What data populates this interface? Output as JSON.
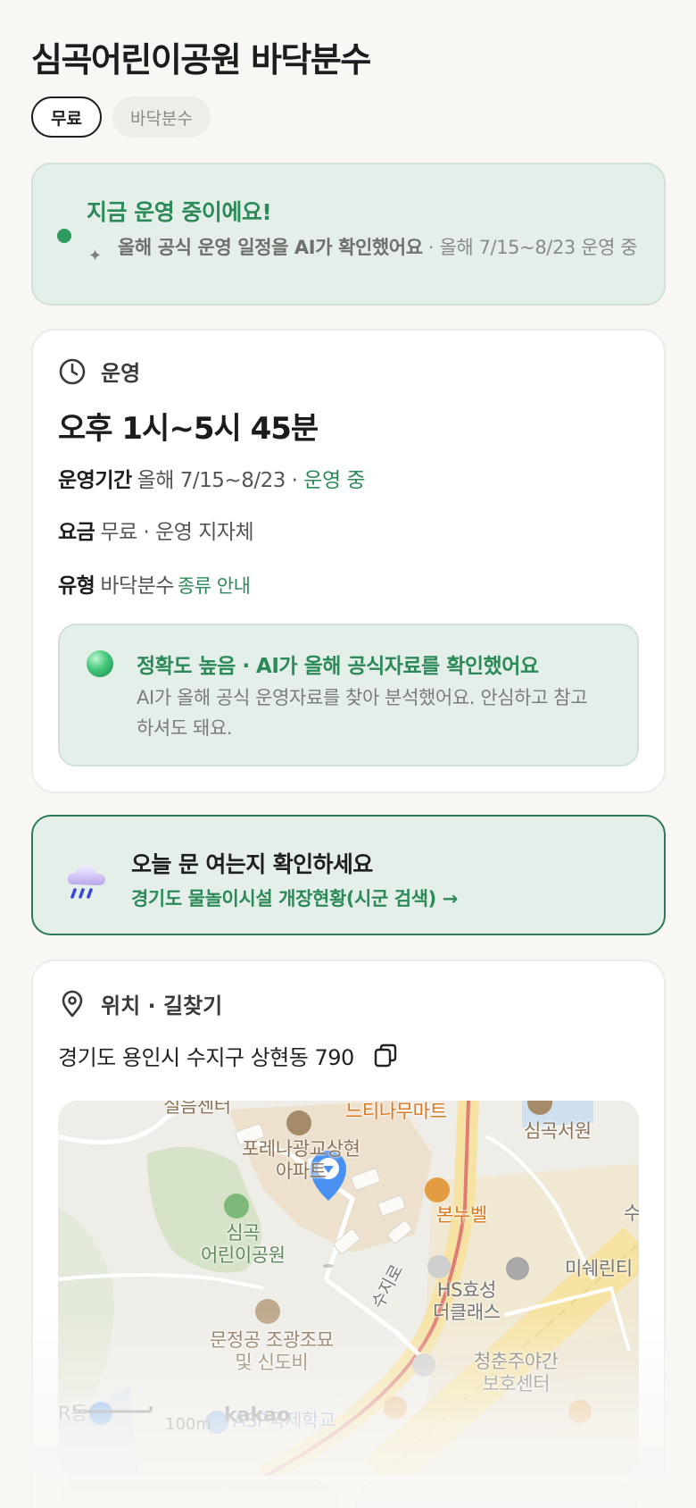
{
  "page": {
    "title": "심곡어린이공원 바닥분수",
    "chips": [
      "무료",
      "바닥분수"
    ]
  },
  "status": {
    "title": "지금 운영 중이에요!",
    "sub_bold": "올해 공식 운영 일정을 AI가 확인했어요",
    "sub_rest": " · 올해 7/15~8/23 운영 중",
    "dot_color": "#2f9b62"
  },
  "operation": {
    "section_label": "운영",
    "section_icon": "clock-icon",
    "hours": "오후 1시~5시 45분",
    "period_label": "운영기간",
    "period_value": "올해 7/15~8/23 · ",
    "period_status": "운영 중",
    "fee_label": "요금",
    "fee_value": "무료 · 운영 지자체",
    "type_label": "유형",
    "type_value": "바닥분수",
    "type_link": "종류 안내",
    "accuracy_title": "정확도 높음 · AI가 올해 공식자료를 확인했어요",
    "accuracy_desc": "AI가 올해 공식 운영자료를 찾아 분석했어요. 안심하고 참고하셔도 돼요."
  },
  "check": {
    "icon": "rain-cloud-icon",
    "title": "오늘 문 여는지 확인하세요",
    "link": "경기도 물놀이시설 개장현황(시군 검색) →"
  },
  "location": {
    "section_label": "위치 · 길찾기",
    "section_icon": "pin-icon",
    "address": "경기도 용인시 수지구 상현동 790",
    "map": {
      "labels": {
        "top_partial": "실음센터",
        "mart": "느티나무마트",
        "library": "심곡서원",
        "apartment": "포레나광교상현\n아파트",
        "bakery": "본누벨",
        "park": "심곡\n어린이공원",
        "road": "수지로",
        "building": "HS효성\n더클래스",
        "beauty": "미쉐린티",
        "tomb": "문정공 조광조묘\n및 신도비",
        "youth_center": "청춘주야간\n보호센터",
        "school": "ASP국제학교",
        "left_partial": "R동",
        "right_partial": "수"
      },
      "scale": "100m",
      "brand": "kakao"
    }
  }
}
